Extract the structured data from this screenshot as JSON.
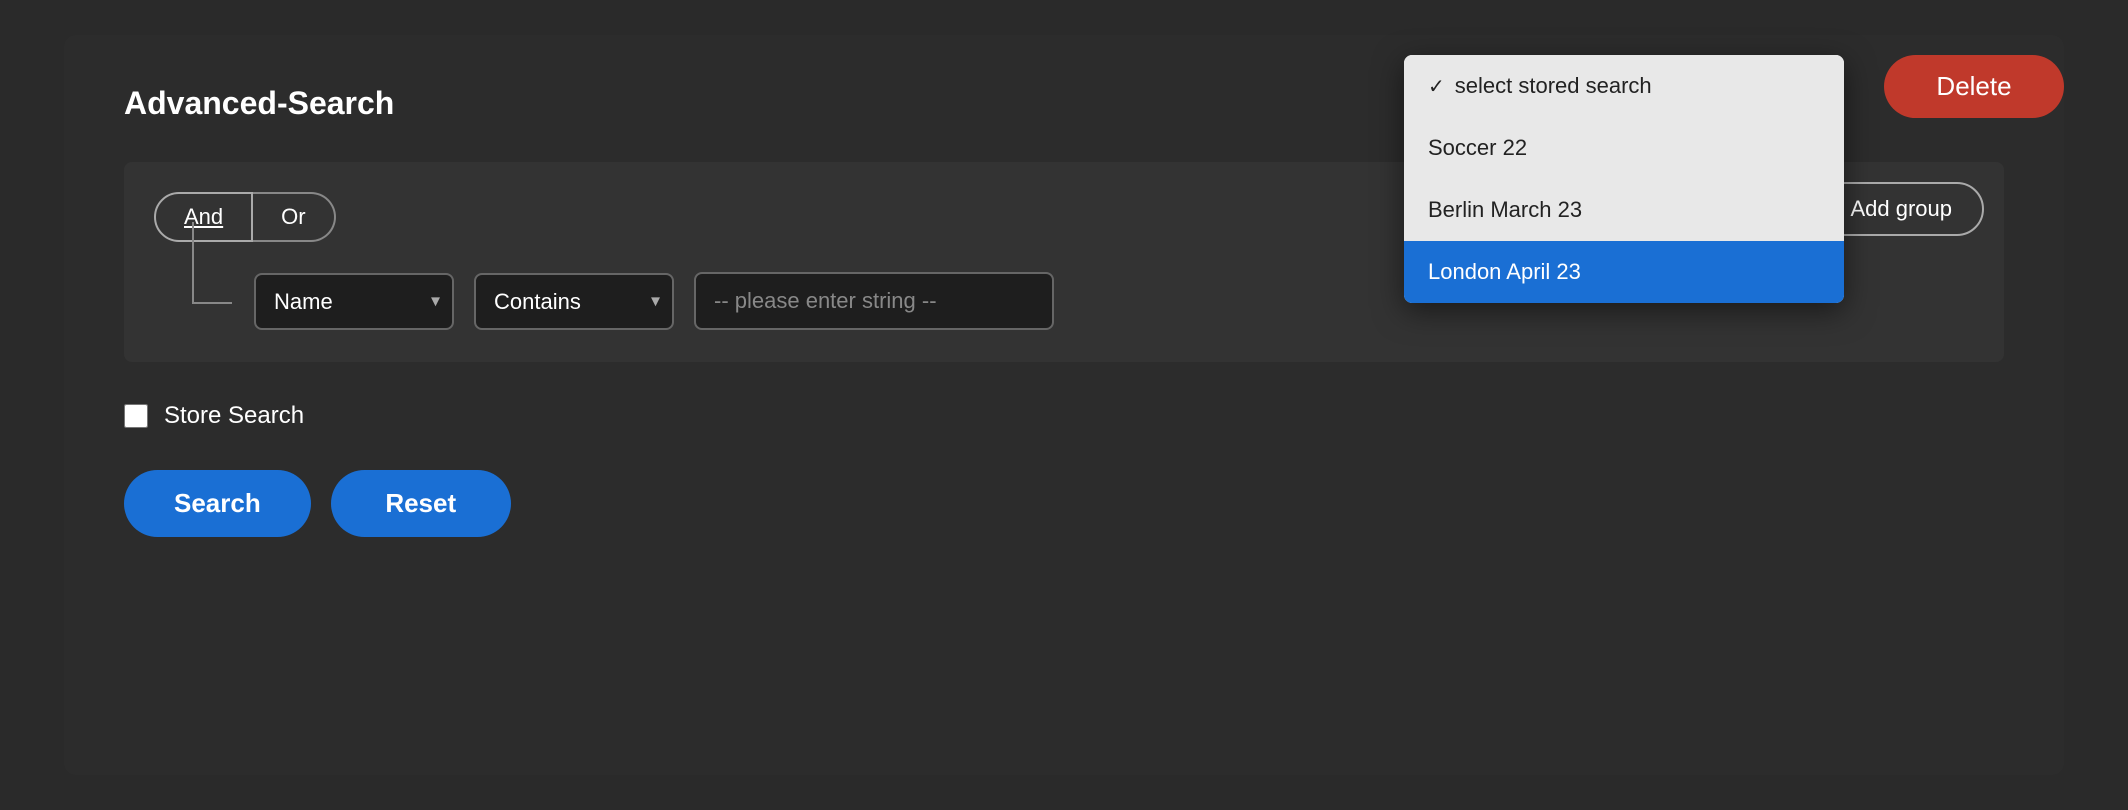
{
  "header": {
    "title": "Advanced-Search"
  },
  "toolbar": {
    "delete_label": "Delete",
    "add_group_label": "Add group"
  },
  "dropdown": {
    "placeholder": "select stored search",
    "items": [
      {
        "id": "select",
        "label": "select stored search",
        "selected": false,
        "checked": true
      },
      {
        "id": "soccer22",
        "label": "Soccer 22",
        "selected": false,
        "checked": false
      },
      {
        "id": "berlin",
        "label": "Berlin March 23",
        "selected": false,
        "checked": false
      },
      {
        "id": "london",
        "label": "London April 23",
        "selected": true,
        "checked": false
      }
    ]
  },
  "filter": {
    "logic_and": "And",
    "logic_or": "Or",
    "field_label": "Name",
    "condition_label": "Contains",
    "string_placeholder": "-- please enter string --"
  },
  "store_search": {
    "label": "Store Search",
    "checked": false
  },
  "actions": {
    "search_label": "Search",
    "reset_label": "Reset"
  }
}
